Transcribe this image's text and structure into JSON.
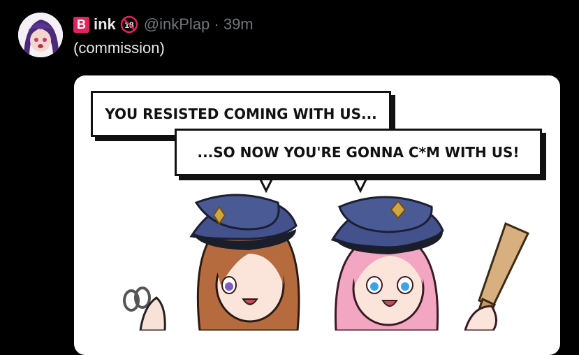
{
  "tweet": {
    "name_badge": "B",
    "display_name": "ink",
    "rating_icon": "18-plus-icon",
    "handle_and_time": "@inkPlap · 39m",
    "text": "(commission)"
  },
  "media": {
    "bubble_1": "YOU RESISTED COMING WITH US...",
    "bubble_2": "...SO NOW YOU'RE GONNA C*M WITH US!"
  },
  "colors": {
    "background": "#000000",
    "text": "#e7e9ea",
    "muted": "#71767b",
    "badge": "#e0245e"
  }
}
